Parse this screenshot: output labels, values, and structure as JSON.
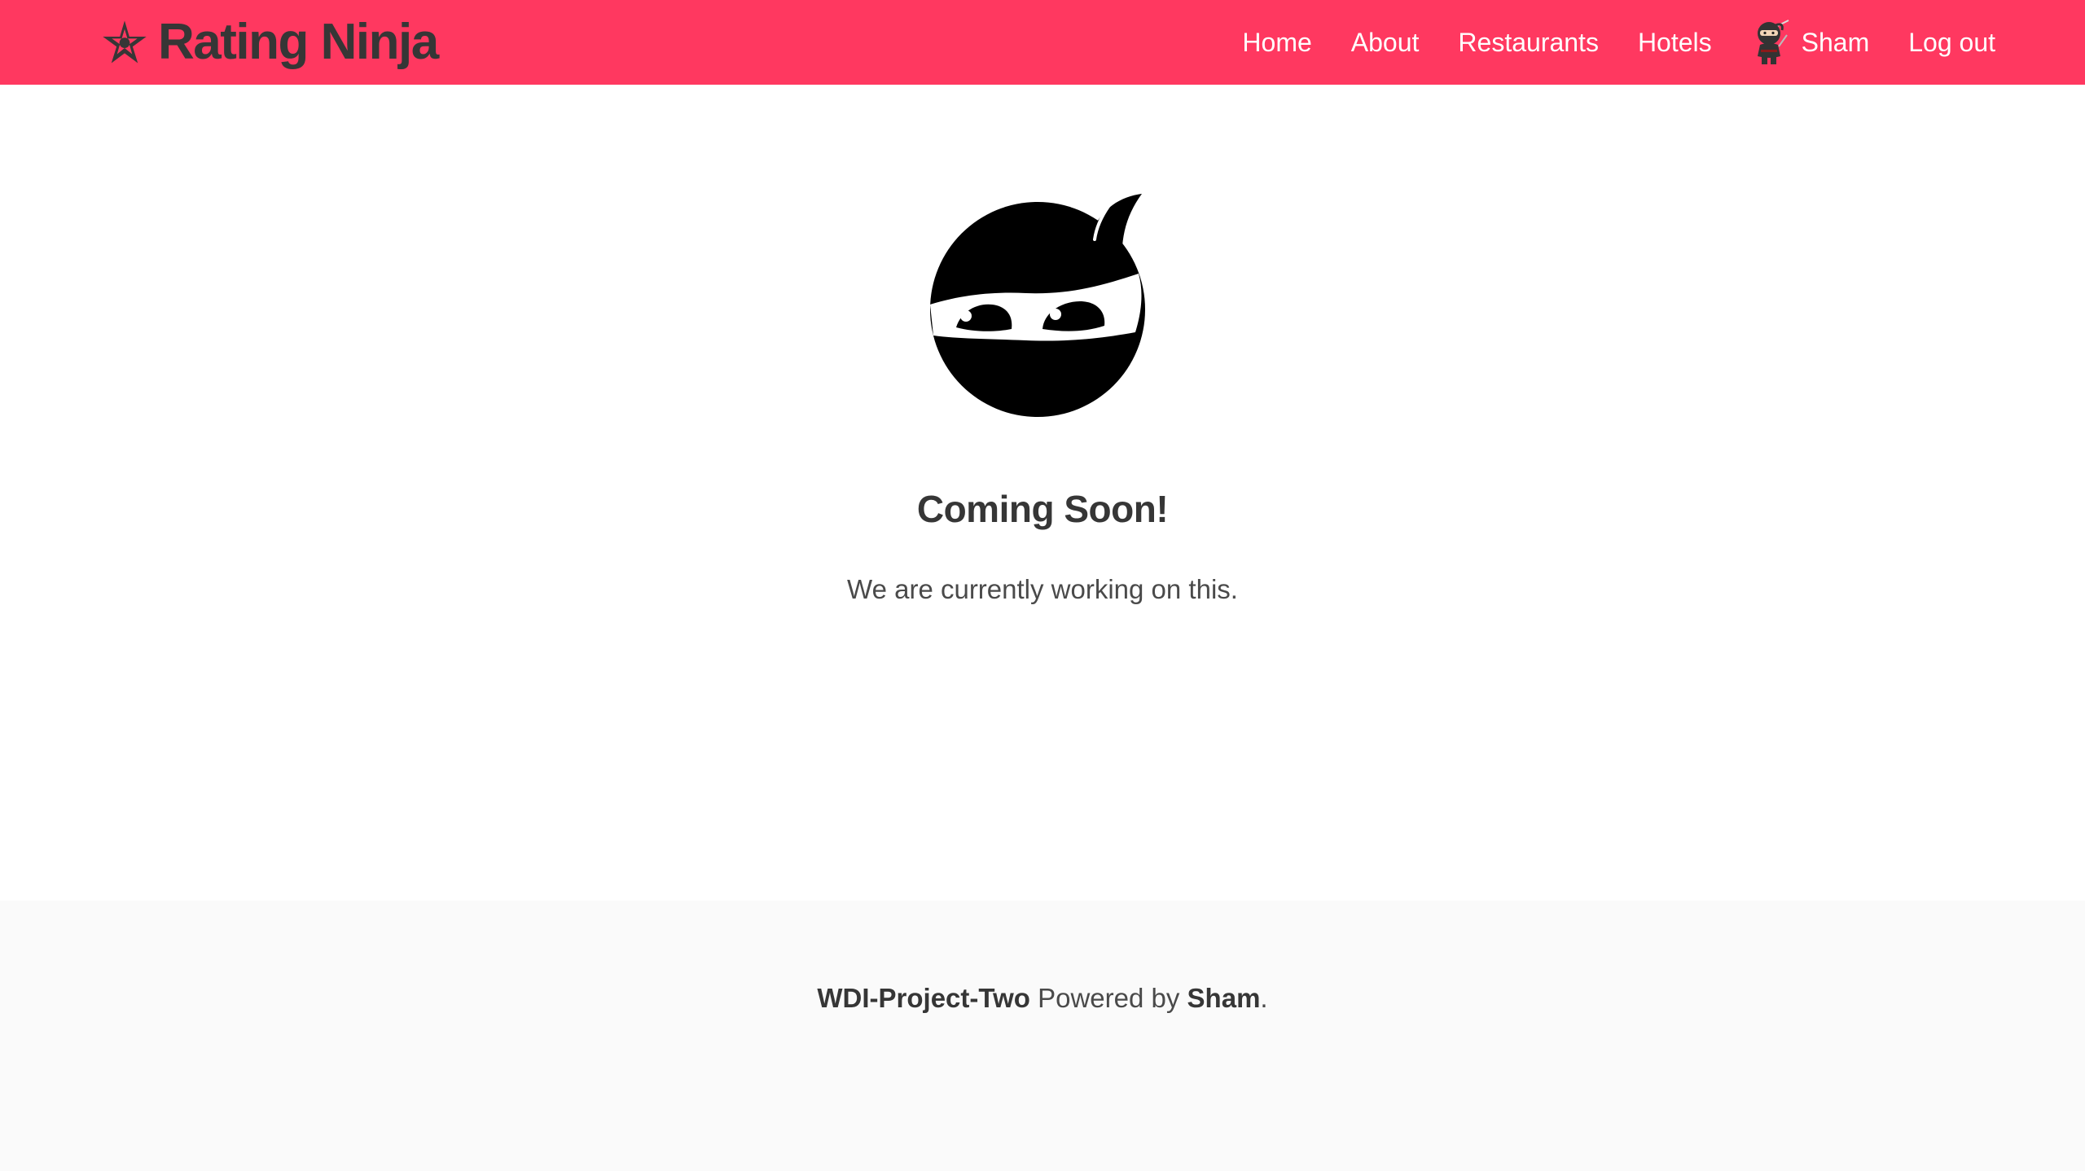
{
  "navbar": {
    "brand": "Rating Ninja",
    "brand_icon": "shuriken-star-icon",
    "background": "#ff3860",
    "items": [
      {
        "label": "Home"
      },
      {
        "label": "About"
      },
      {
        "label": "Restaurants"
      },
      {
        "label": "Hotels"
      },
      {
        "label": "Sham",
        "icon": "ninja-avatar-icon"
      },
      {
        "label": "Log out"
      }
    ]
  },
  "main": {
    "logo_icon": "ninja-head-icon",
    "title": "Coming Soon!",
    "subtitle": "We are currently working on this."
  },
  "footer": {
    "project": "WDI-Project-Two",
    "powered_by": " Powered by ",
    "author": "Sham",
    "end": "."
  }
}
